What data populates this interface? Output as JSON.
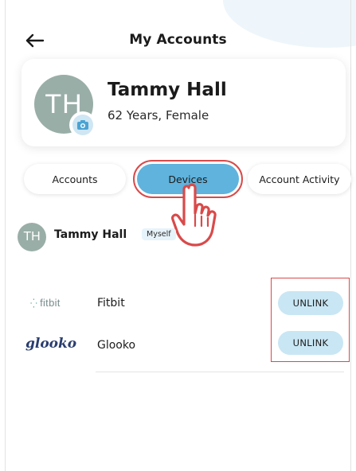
{
  "header": {
    "title": "My Accounts",
    "back_icon": "arrow-left-icon"
  },
  "profile": {
    "initials": "TH",
    "name": "Tammy Hall",
    "subtitle": "62 Years, Female",
    "avatar_color": "#9aaea8",
    "camera_icon": "camera-icon"
  },
  "tabs": [
    {
      "label": "Accounts",
      "selected": false
    },
    {
      "label": "Devices",
      "selected": true
    },
    {
      "label": "Account Activity",
      "selected": false
    }
  ],
  "member": {
    "initials": "TH",
    "name": "Tammy Hall",
    "badge": "Myself"
  },
  "devices": [
    {
      "brand_logo": "fitbit",
      "name": "Fitbit",
      "action_label": "UNLINK"
    },
    {
      "brand_logo": "glooko",
      "name": "Glooko",
      "action_label": "UNLINK"
    }
  ],
  "colors": {
    "accent": "#5fb3dd",
    "unlink_bg": "#c9e6f4",
    "highlight": "#d94a4a"
  }
}
